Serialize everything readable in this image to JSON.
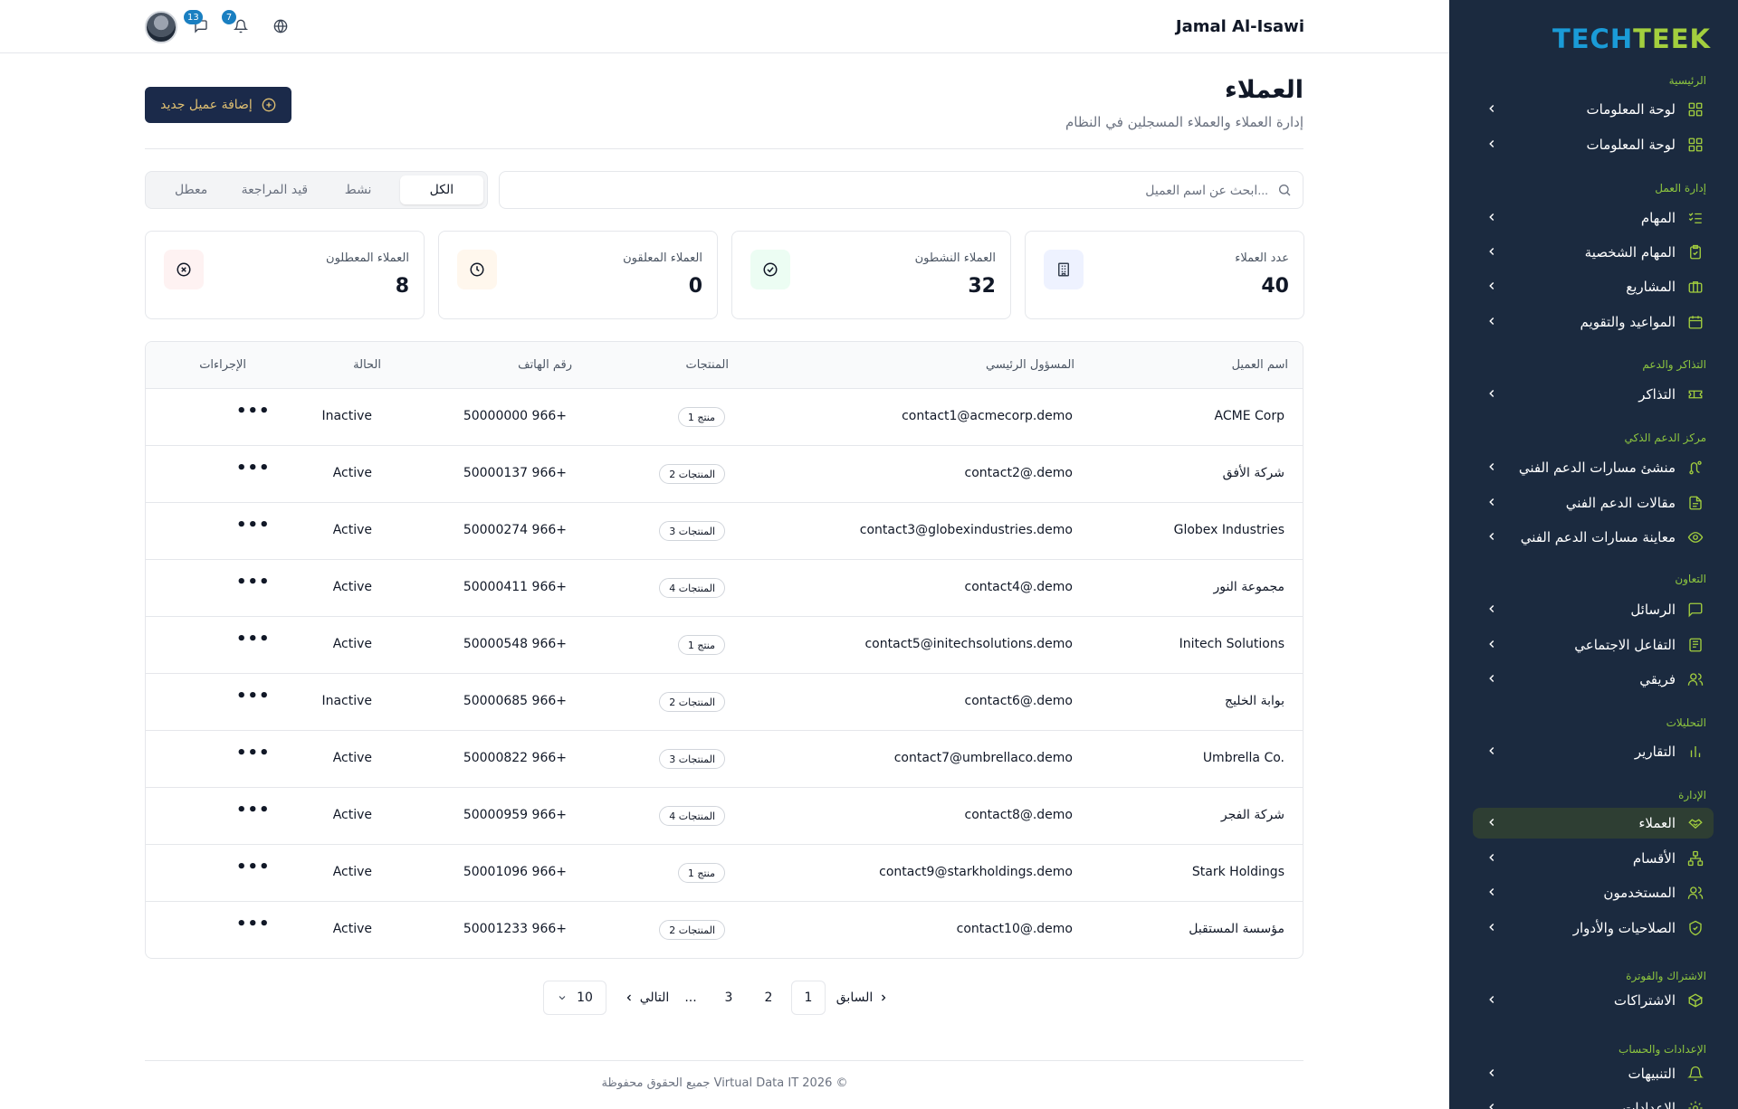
{
  "sidebar": {
    "logo_part1": "TECH",
    "logo_part2": "TEEK",
    "sections": [
      "الرئيسية",
      "إدارة العمل",
      "التذاكر والدعم",
      "مركز الدعم الذكي",
      "التعاون",
      "التحليلات",
      "الإدارة",
      "الاشتراك والفوترة",
      "الإعدادات والحساب"
    ],
    "items": [
      {
        "label": "لوحة المعلومات",
        "icon": "grid-icon"
      },
      {
        "label": "لوحة المعلومات",
        "icon": "grid-icon"
      },
      {
        "label": "المهام",
        "icon": "list-check-icon"
      },
      {
        "label": "المهام الشخصية",
        "icon": "clipboard-check-icon"
      },
      {
        "label": "المشاريع",
        "icon": "briefcase-icon"
      },
      {
        "label": "المواعيد والتقويم",
        "icon": "calendar-icon"
      },
      {
        "label": "التذاكر",
        "icon": "ticket-icon"
      },
      {
        "label": "منشئ مسارات الدعم الفني",
        "icon": "route-icon"
      },
      {
        "label": "مقالات الدعم الفني",
        "icon": "document-icon"
      },
      {
        "label": "معاينة مسارات الدعم الفني",
        "icon": "eye-icon"
      },
      {
        "label": "الرسائل",
        "icon": "message-icon"
      },
      {
        "label": "التفاعل الاجتماعي",
        "icon": "newspaper-icon"
      },
      {
        "label": "فريقي",
        "icon": "users-icon"
      },
      {
        "label": "التقارير",
        "icon": "bar-chart-icon"
      },
      {
        "label": "العملاء",
        "icon": "handshake-icon"
      },
      {
        "label": "الأقسام",
        "icon": "hierarchy-icon"
      },
      {
        "label": "المستخدمون",
        "icon": "users-icon"
      },
      {
        "label": "الصلاحيات والأدوار",
        "icon": "shield-check-icon"
      },
      {
        "label": "الاشتراكات",
        "icon": "package-icon"
      },
      {
        "label": "التنبيهات",
        "icon": "bell-icon"
      },
      {
        "label": "الإعدادات",
        "icon": "gear-icon"
      }
    ],
    "active_index": 14
  },
  "topbar": {
    "user_name": "Jamal Al-Isawi",
    "messages_count": "13",
    "notifications_count": "7"
  },
  "header": {
    "title": "العملاء",
    "subtitle": "إدارة العملاء والعملاء المسجلين في النظام",
    "add_button": "إضافة عميل جديد"
  },
  "search": {
    "placeholder": "ابحث عن اسم العميل...",
    "value": ""
  },
  "filters": {
    "tabs": [
      "الكل",
      "نشط",
      "قيد المراجعة",
      "معطل"
    ],
    "active": 0
  },
  "stats": [
    {
      "label": "عدد العملاء",
      "value": "40",
      "icon": "building-icon",
      "color": "#eef2ff"
    },
    {
      "label": "العملاء النشطون",
      "value": "32",
      "icon": "check-circle-icon",
      "color": "#ecfdf3"
    },
    {
      "label": "العملاء المعلقون",
      "value": "0",
      "icon": "clock-icon",
      "color": "#fff7ed"
    },
    {
      "label": "العملاء المعطلون",
      "value": "8",
      "icon": "x-circle-icon",
      "color": "#fef2f2"
    }
  ],
  "table": {
    "columns": [
      "اسم العميل",
      "المسؤول الرئيسي",
      "المنتجات",
      "رقم الهاتف",
      "الحالة",
      "الإجراءات"
    ],
    "rows": [
      {
        "name": "ACME Corp",
        "contact": "contact1@acmecorp.demo",
        "products": "1 منتج",
        "phone": "+966 50000000",
        "status": "Inactive"
      },
      {
        "name": "شركة الأفق",
        "contact": "contact2@.demo",
        "products": "2 المنتجات",
        "phone": "+966 50000137",
        "status": "Active"
      },
      {
        "name": "Globex Industries",
        "contact": "contact3@globexindustries.demo",
        "products": "3 المنتجات",
        "phone": "+966 50000274",
        "status": "Active"
      },
      {
        "name": "مجموعة النور",
        "contact": "contact4@.demo",
        "products": "4 المنتجات",
        "phone": "+966 50000411",
        "status": "Active"
      },
      {
        "name": "Initech Solutions",
        "contact": "contact5@initechsolutions.demo",
        "products": "1 منتج",
        "phone": "+966 50000548",
        "status": "Active"
      },
      {
        "name": "بوابة الخليج",
        "contact": "contact6@.demo",
        "products": "2 المنتجات",
        "phone": "+966 50000685",
        "status": "Inactive"
      },
      {
        "name": "Umbrella Co.",
        "contact": "contact7@umbrellaco.demo",
        "products": "3 المنتجات",
        "phone": "+966 50000822",
        "status": "Active"
      },
      {
        "name": "شركة الفجر",
        "contact": "contact8@.demo",
        "products": "4 المنتجات",
        "phone": "+966 50000959",
        "status": "Active"
      },
      {
        "name": "Stark Holdings",
        "contact": "contact9@starkholdings.demo",
        "products": "1 منتج",
        "phone": "+966 50001096",
        "status": "Active"
      },
      {
        "name": "مؤسسة المستقبل",
        "contact": "contact10@.demo",
        "products": "2 المنتجات",
        "phone": "+966 50001233",
        "status": "Active"
      }
    ],
    "actions_label": "•••"
  },
  "pagination": {
    "prev": "السابق",
    "pages": [
      "1",
      "2",
      "3"
    ],
    "ellipsis": "...",
    "next": "التالي",
    "current": "1",
    "page_size": "10"
  },
  "footer": {
    "text": "جميع الحقوق محفوظة Virtual Data IT 2026 ©"
  }
}
